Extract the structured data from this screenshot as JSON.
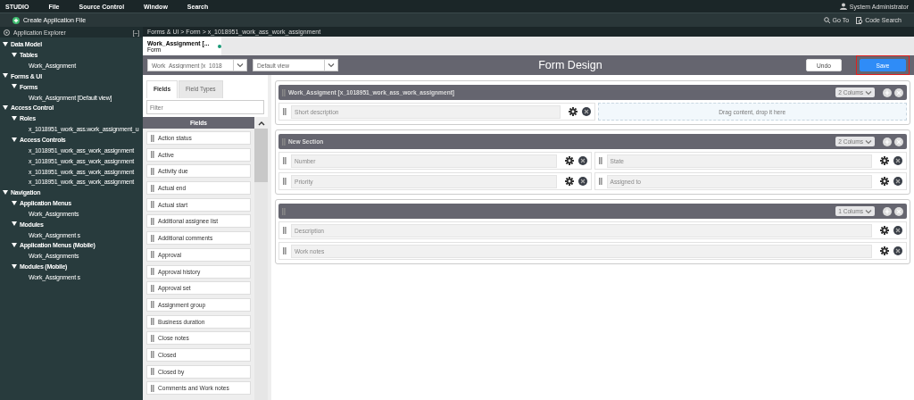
{
  "menu_bar": {
    "items": [
      "STUDIO",
      "File",
      "Source Control",
      "Window",
      "Search"
    ],
    "user": "System Administrator"
  },
  "app_bar": {
    "create": "Create Application File",
    "links": [
      {
        "kind": "goto",
        "label": "Go To"
      },
      {
        "kind": "search",
        "label": "Code Search"
      }
    ]
  },
  "explorer": {
    "title": "Application Explorer",
    "collapse": "[–]",
    "tree": [
      {
        "label": "Data Model",
        "expanded": true,
        "children": [
          {
            "label": "Tables",
            "expanded": true,
            "children": [
              {
                "label": "Work_Assignment"
              }
            ]
          }
        ]
      },
      {
        "label": "Forms & UI",
        "expanded": true,
        "children": [
          {
            "label": "Forms",
            "expanded": true,
            "children": [
              {
                "label": "Work_Assignment [Default view]"
              }
            ]
          }
        ]
      },
      {
        "label": "Access Control",
        "expanded": true,
        "children": [
          {
            "label": "Roles",
            "expanded": true,
            "children": [
              {
                "label": "x_1018951_work_ass.work_assignment_u"
              }
            ]
          },
          {
            "label": "Access Controls",
            "expanded": true,
            "children": [
              {
                "label": "x_1018951_work_ass_work_assignment"
              },
              {
                "label": "x_1018951_work_ass_work_assignment"
              },
              {
                "label": "x_1018951_work_ass_work_assignment"
              },
              {
                "label": "x_1018951_work_ass_work_assignment"
              }
            ]
          }
        ]
      },
      {
        "label": "Navigation",
        "expanded": true,
        "children": [
          {
            "label": "Application Menus",
            "expanded": true,
            "children": [
              {
                "label": "Work_Assignments"
              }
            ]
          },
          {
            "label": "Modules",
            "expanded": true,
            "children": [
              {
                "label": "Work_Assignment s"
              }
            ]
          },
          {
            "label": "Application Menus (Mobile)",
            "expanded": true,
            "children": [
              {
                "label": "Work_Assignments"
              }
            ]
          },
          {
            "label": "Modules (Mobile)",
            "expanded": true,
            "children": [
              {
                "label": "Work_Assignment s"
              }
            ]
          }
        ]
      }
    ]
  },
  "breadcrumb": "Forms & UI > Form > x_1018951_work_ass_work_assignment",
  "editor_tabs": [
    {
      "title": "Work_Assignment [...",
      "subtitle": "Form",
      "modified": true,
      "selected": true
    }
  ],
  "toolbar": {
    "table_select": "Work_Assignment [x_1018",
    "view_select": "Default view",
    "title": "Form Design",
    "buttons": [
      {
        "label": "Undo",
        "kind": "secondary",
        "highlighted": false
      },
      {
        "label": "Save",
        "kind": "primary",
        "highlighted": true
      }
    ]
  },
  "palette": {
    "tabs": [
      {
        "label": "Fields",
        "selected": true
      },
      {
        "label": "Field Types",
        "selected": false
      }
    ],
    "filter_placeholder": "Filter",
    "header": "Fields",
    "fields": [
      "Action status",
      "Active",
      "Activity due",
      "Actual end",
      "Actual start",
      "Additional assignee list",
      "Additional comments",
      "Approval",
      "Approval history",
      "Approval set",
      "Assignment group",
      "Business duration",
      "Close notes",
      "Closed",
      "Closed by",
      "Comments and Work notes"
    ]
  },
  "sections": [
    {
      "title": "Work_Assigment  [x_1018951_work_ass_work_assignment]",
      "columns_label": "2 Colums",
      "rows": [
        [
          {
            "kind": "field",
            "label": "Short description"
          },
          {
            "kind": "dropzone",
            "label": "Drag content, drop it here"
          }
        ]
      ]
    },
    {
      "title": "New Section",
      "columns_label": "2 Colums",
      "rows": [
        [
          {
            "kind": "field",
            "label": "Number"
          },
          {
            "kind": "field",
            "label": "State"
          }
        ],
        [
          {
            "kind": "field",
            "label": "Priority"
          },
          {
            "kind": "field",
            "label": "Assigned to"
          }
        ]
      ]
    },
    {
      "columns_label": "1 Colums",
      "rows": [
        [
          {
            "kind": "field",
            "label": "Description"
          }
        ],
        [
          {
            "kind": "field",
            "label": "Work notes"
          }
        ]
      ]
    }
  ]
}
